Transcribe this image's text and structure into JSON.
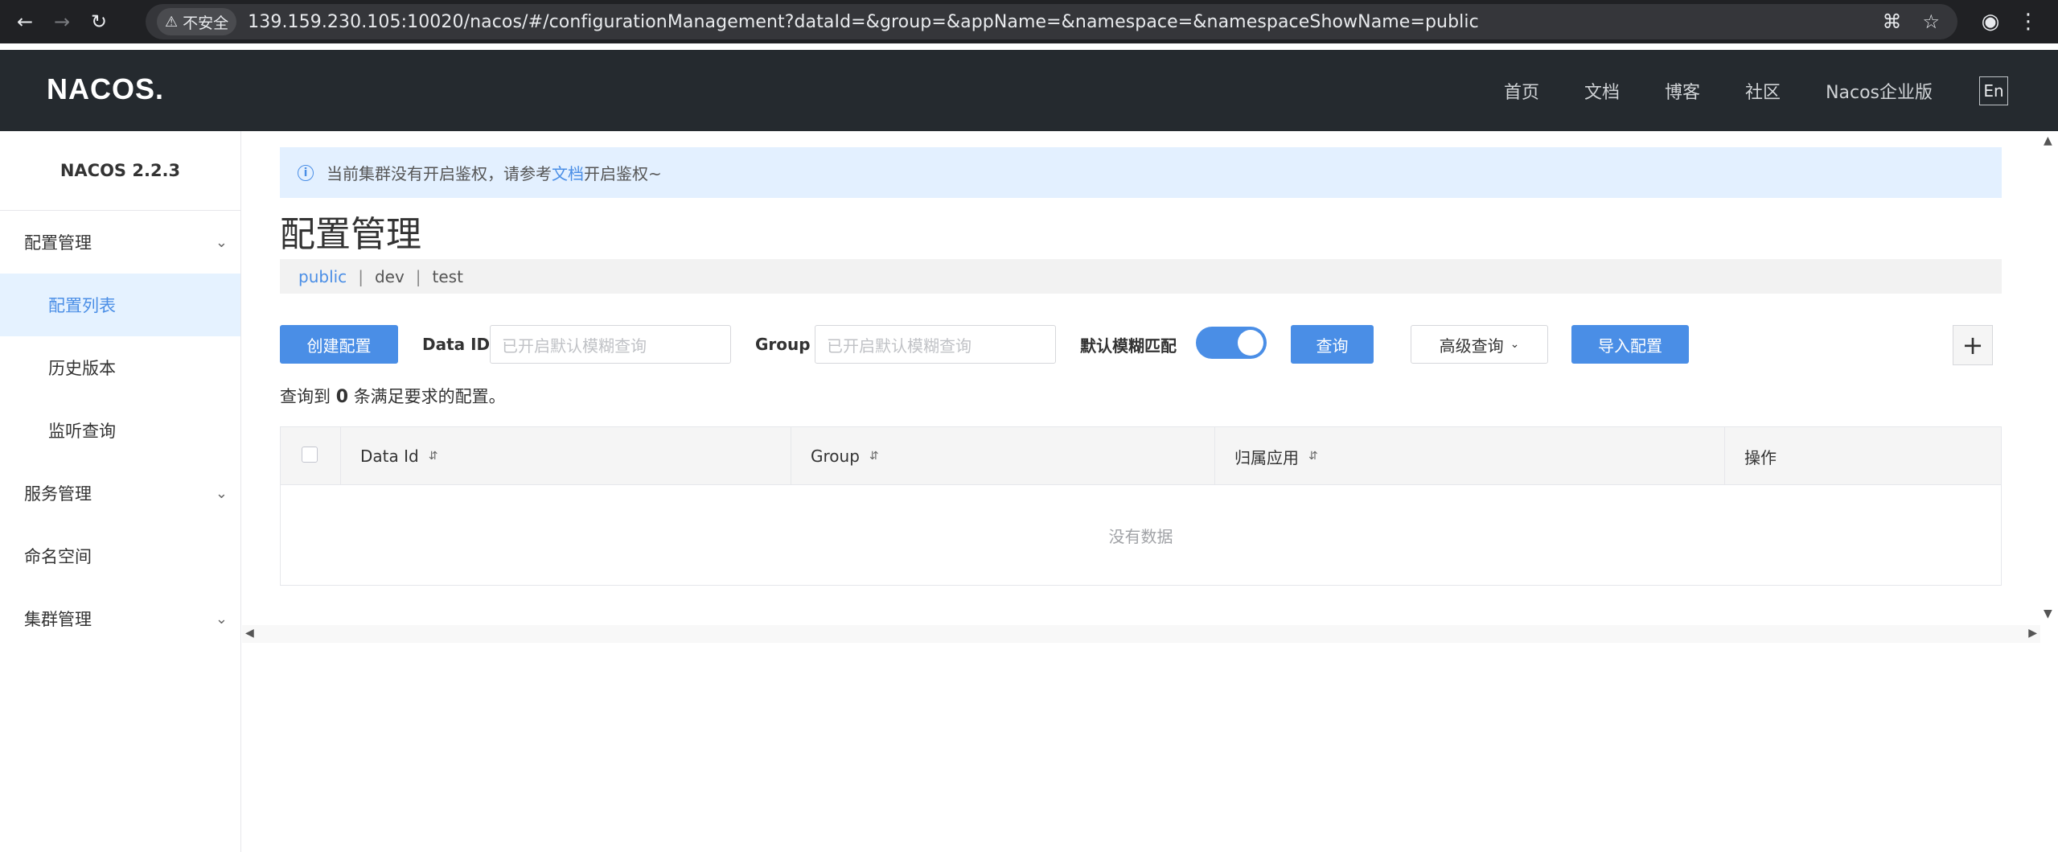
{
  "browser": {
    "security_label": "不安全",
    "url": "139.159.230.105:10020/nacos/#/configurationManagement?dataId=&group=&appName=&namespace=&namespaceShowName=public",
    "icons": [
      "back-icon",
      "forward-icon",
      "reload-icon",
      "translate-icon",
      "star-icon",
      "profile-icon",
      "menu-icon"
    ]
  },
  "header": {
    "logo": "NACOS.",
    "nav": [
      "首页",
      "文档",
      "博客",
      "社区",
      "Nacos企业版"
    ],
    "lang": "En"
  },
  "sidebar": {
    "version": "NACOS 2.2.3",
    "groups": [
      {
        "label": "配置管理",
        "items": [
          "配置列表",
          "历史版本",
          "监听查询"
        ],
        "active": "配置列表"
      },
      {
        "label": "服务管理"
      },
      {
        "label": "命名空间"
      },
      {
        "label": "集群管理"
      }
    ]
  },
  "notice": {
    "prefix": "当前集群没有开启鉴权，请参考",
    "link": "文档",
    "suffix": "开启鉴权~"
  },
  "page": {
    "title": "配置管理",
    "namespaces": [
      "public",
      "dev",
      "test"
    ],
    "active_namespace": "public"
  },
  "toolbar": {
    "create_label": "创建配置",
    "dataid_label": "Data ID",
    "dataid_placeholder": "已开启默认模糊查询",
    "group_label": "Group",
    "group_placeholder": "已开启默认模糊查询",
    "fuzzy_label": "默认模糊匹配",
    "fuzzy_on": true,
    "query_label": "查询",
    "advanced_label": "高级查询",
    "import_label": "导入配置"
  },
  "result": {
    "prefix": "查询到",
    "count": "0",
    "suffix": "条满足要求的配置。"
  },
  "table": {
    "columns": [
      "Data Id",
      "Group",
      "归属应用",
      "操作"
    ],
    "empty_text": "没有数据"
  },
  "colors": {
    "primary": "#4a8ee6",
    "header_bg": "#252a2f",
    "active_bg": "#e5f2ff",
    "notice_bg": "#e3f0ff"
  }
}
